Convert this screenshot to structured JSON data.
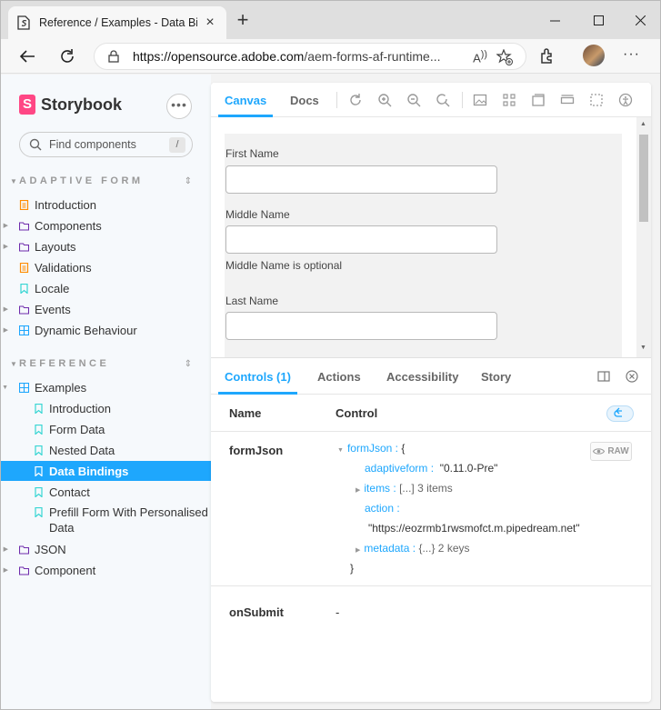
{
  "browser": {
    "tab_title": "Reference / Examples - Data Binc",
    "url_host": "https://opensource.adobe.com",
    "url_path": "/aem-forms-af-runtime..."
  },
  "sidebar": {
    "brand": "Storybook",
    "menu_glyph": "•••",
    "search_placeholder": "Find components",
    "search_shortcut": "/",
    "sections": [
      {
        "title": "ADAPTIVE FORM",
        "items": [
          {
            "label": "Introduction",
            "icon": "document-icon"
          },
          {
            "label": "Components",
            "icon": "folder-icon"
          },
          {
            "label": "Layouts",
            "icon": "folder-icon"
          },
          {
            "label": "Validations",
            "icon": "document-icon"
          },
          {
            "label": "Locale",
            "icon": "bookmark-icon"
          },
          {
            "label": "Events",
            "icon": "folder-icon"
          },
          {
            "label": "Dynamic Behaviour",
            "icon": "component-icon"
          }
        ]
      },
      {
        "title": "REFERENCE",
        "items": [
          {
            "label": "Examples",
            "icon": "component-icon"
          },
          {
            "label": "Introduction",
            "icon": "bookmark-icon"
          },
          {
            "label": "Form Data",
            "icon": "bookmark-icon"
          },
          {
            "label": "Nested Data",
            "icon": "bookmark-icon"
          },
          {
            "label": "Data Bindings",
            "icon": "bookmark-icon",
            "selected": true
          },
          {
            "label": "Contact",
            "icon": "bookmark-icon"
          },
          {
            "label": "Prefill Form With Personalised Data",
            "line1": "Prefill Form With Personalised",
            "line2": "Data",
            "icon": "bookmark-icon"
          },
          {
            "label": "JSON",
            "icon": "folder-icon"
          },
          {
            "label": "Component",
            "icon": "folder-icon"
          }
        ]
      }
    ]
  },
  "toolbar": {
    "tabs": [
      "Canvas",
      "Docs"
    ],
    "active_tab": "Canvas"
  },
  "preview": {
    "fields": [
      {
        "label": "First Name",
        "value": ""
      },
      {
        "label": "Middle Name",
        "value": "",
        "help": "Middle Name is optional"
      },
      {
        "label": "Last Name",
        "value": ""
      }
    ]
  },
  "addons": {
    "tabs": [
      "Controls (1)",
      "Actions",
      "Accessibility",
      "Story"
    ],
    "active_tab": "Controls (1)",
    "columns": [
      "Name",
      "Control"
    ],
    "rows": [
      {
        "name": "formJson",
        "root_key": "formJson",
        "open": "{",
        "close": "}",
        "raw_label": "RAW",
        "entries": [
          {
            "key": "adaptiveform",
            "value": "\"0.11.0-Pre\""
          },
          {
            "key": "items",
            "value": "[...] 3 items"
          },
          {
            "key": "action",
            "value": "\"https://eozrmb1rwsmofct.m.pipedream.net\""
          },
          {
            "key": "metadata",
            "value": "{...} 2 keys"
          }
        ]
      },
      {
        "name": "onSubmit",
        "value": "-"
      }
    ]
  },
  "colors": {
    "accent": "#1ea7fd",
    "brand": "#ff4785",
    "sidebar_bg": "#f6f9fc"
  }
}
